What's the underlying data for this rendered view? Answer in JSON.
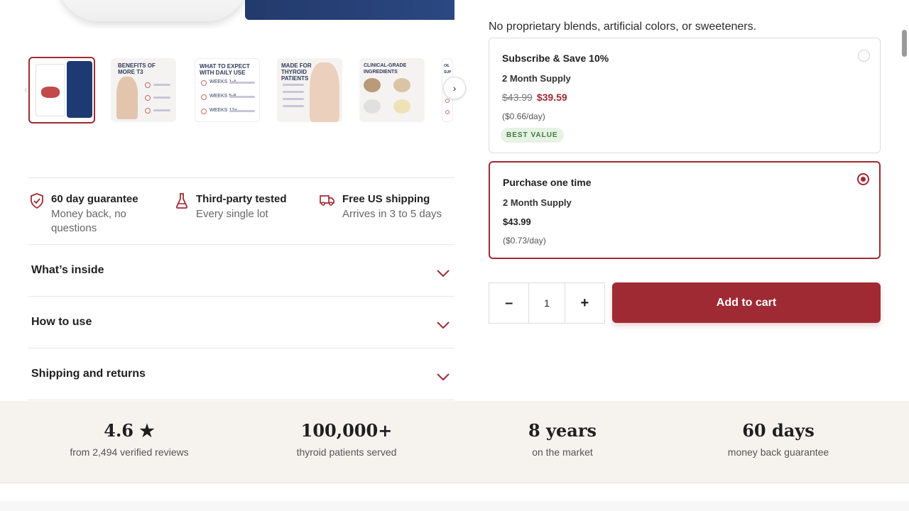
{
  "gallery": {
    "thumbnails": [
      {
        "title": ""
      },
      {
        "title": "BENEFITS OF MORE T3"
      },
      {
        "title": "WHAT TO EXPECT WITH DAILY USE",
        "lines": [
          "WEEKS 1-4",
          "WEEKS 5-8",
          "WEEKS 12+"
        ]
      },
      {
        "title": "MADE FOR THYROID PATIENTS"
      },
      {
        "title": "CLINICAL-GRADE INGREDIENTS"
      },
      {
        "title": "OIL SUP"
      }
    ],
    "prev_icon": "‹",
    "next_icon": "›"
  },
  "features": [
    {
      "icon": "shield-check-icon",
      "title": "60 day guarantee",
      "subtitle": "Money back, no questions"
    },
    {
      "icon": "flask-icon",
      "title": "Third-party tested",
      "subtitle": "Every single lot"
    },
    {
      "icon": "truck-icon",
      "title": "Free US shipping",
      "subtitle": "Arrives in 3 to 5 days"
    }
  ],
  "accordion": [
    {
      "label": "What’s inside"
    },
    {
      "label": "How to use"
    },
    {
      "label": "Shipping and returns"
    }
  ],
  "purchase": {
    "tagline": "No proprietary blends, artificial colors, or sweeteners.",
    "options": [
      {
        "title": "Subscribe & Save 10%",
        "supply": "2 Month Supply",
        "old_price": "$43.99",
        "price": "$39.59",
        "per_day": "($0.66/day)",
        "badge": "BEST VALUE",
        "selected": false
      },
      {
        "title": "Purchase one time",
        "supply": "2 Month Supply",
        "price": "$43.99",
        "per_day": "($0.73/day)",
        "selected": true
      }
    ],
    "quantity": {
      "minus": "–",
      "value": "1",
      "plus": "+"
    },
    "add_to_cart": "Add to cart"
  },
  "stats": [
    {
      "value": "4.6 ★",
      "label": "from 2,494 verified reviews"
    },
    {
      "value": "100,000+",
      "label": "thyroid patients served"
    },
    {
      "value": "8 years",
      "label": "on the market"
    },
    {
      "value": "60 days",
      "label": "money back guarantee"
    }
  ],
  "colors": {
    "accent": "#a02a34",
    "badge_bg": "#e6f2e4",
    "badge_text": "#3f7a3a",
    "stats_bg": "#f6f3ef"
  }
}
